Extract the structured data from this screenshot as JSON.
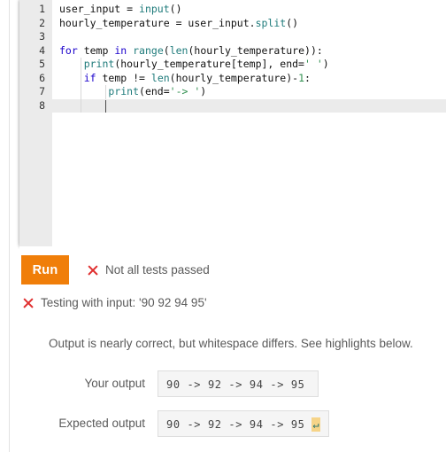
{
  "editor": {
    "name": "code-editor",
    "total_lines": 8,
    "active_line": 8,
    "lines": [
      {
        "n": "1",
        "text": "user_input = input()"
      },
      {
        "n": "2",
        "text": "hourly_temperature = user_input.split()"
      },
      {
        "n": "3",
        "text": ""
      },
      {
        "n": "4",
        "text": "for temp in range(len(hourly_temperature)):"
      },
      {
        "n": "5",
        "text": "    print(hourly_temperature[temp], end=' ')"
      },
      {
        "n": "6",
        "text": "    if temp != len(hourly_temperature)-1:"
      },
      {
        "n": "7",
        "text": "        print(end='-> ')"
      },
      {
        "n": "8",
        "text": ""
      }
    ]
  },
  "toolbar": {
    "run_label": "Run",
    "run_color": "#f07e09"
  },
  "results": {
    "error_icon": "x-mark-icon",
    "error_color": "#e03030",
    "status_label": "Not all tests passed",
    "test_case_label": "Testing with input: '90 92 94 95'",
    "diff_message": "Output is nearly correct, but whitespace differs. See highlights below.",
    "your_output": {
      "label": "Your output",
      "value": "90 -> 92 -> 94 -> 95"
    },
    "expected_output": {
      "label": "Expected output",
      "value": "90 -> 92 -> 94 -> 95 ",
      "whitespace_marker": "↵",
      "highlight_color": "#f6d488"
    }
  }
}
